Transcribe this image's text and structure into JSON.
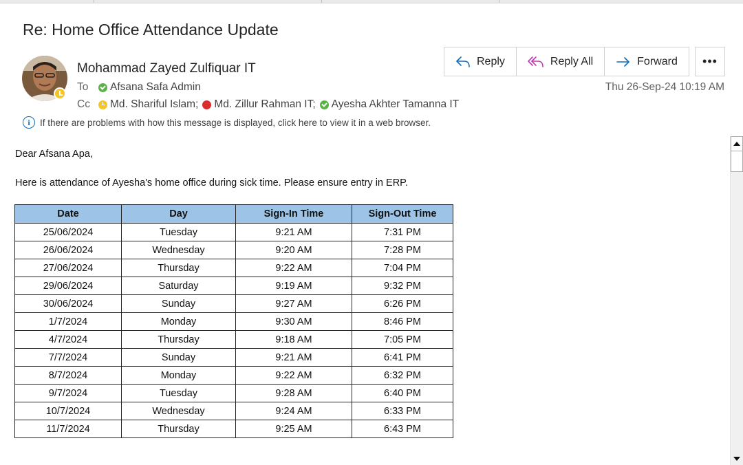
{
  "message": {
    "subject": "Re: Home Office Attendance Update",
    "sender": "Mohammad Zayed Zulfiquar IT",
    "to_label": "To",
    "cc_label": "Cc",
    "to": [
      {
        "name": "Afsana Safa Admin",
        "status": "available"
      }
    ],
    "cc": [
      {
        "name": "Md. Shariful Islam;",
        "status": "away"
      },
      {
        "name": "Md. Zillur Rahman IT;",
        "status": "busy"
      },
      {
        "name": "Ayesha Akhter Tamanna IT",
        "status": "available"
      }
    ],
    "date": "Thu 26-Sep-24 10:19 AM",
    "info_bar": "If there are problems with how this message is displayed, click here to view it in a web browser."
  },
  "actions": {
    "reply": "Reply",
    "reply_all": "Reply All",
    "forward": "Forward",
    "more": "•••"
  },
  "body": {
    "greeting": "Dear Afsana Apa,",
    "paragraph": "Here is attendance of Ayesha's home office during sick time. Please ensure entry in ERP."
  },
  "table": {
    "headers": [
      "Date",
      "Day",
      "Sign-In Time",
      "Sign-Out Time"
    ],
    "rows": [
      [
        "25/06/2024",
        "Tuesday",
        "9:21 AM",
        "7:31 PM"
      ],
      [
        "26/06/2024",
        "Wednesday",
        "9:20 AM",
        "7:28 PM"
      ],
      [
        "27/06/2024",
        "Thursday",
        "9:22 AM",
        "7:04 PM"
      ],
      [
        "29/06/2024",
        "Saturday",
        "9:19 AM",
        "9:32 PM"
      ],
      [
        "30/06/2024",
        "Sunday",
        "9:27 AM",
        "6:26 PM"
      ],
      [
        "1/7/2024",
        "Monday",
        "9:30 AM",
        "8:46 PM"
      ],
      [
        "4/7/2024",
        "Thursday",
        "9:18 AM",
        "7:05 PM"
      ],
      [
        "7/7/2024",
        "Sunday",
        "9:21 AM",
        "6:41 PM"
      ],
      [
        "8/7/2024",
        "Monday",
        "9:22 AM",
        "6:32 PM"
      ],
      [
        "9/7/2024",
        "Tuesday",
        "9:28 AM",
        "6:40 PM"
      ],
      [
        "10/7/2024",
        "Wednesday",
        "9:24 AM",
        "6:33 PM"
      ],
      [
        "11/7/2024",
        "Thursday",
        "9:25 AM",
        "6:43 PM"
      ]
    ]
  },
  "icons": {
    "reply": "reply-arrow-icon",
    "reply_all": "reply-all-arrow-icon",
    "forward": "forward-arrow-icon",
    "info": "info-circle-icon",
    "presence_available": "presence-available-icon",
    "presence_away": "presence-away-icon",
    "presence_busy": "presence-busy-icon"
  },
  "colors": {
    "accent": "#0f6cbd",
    "table_header": "#9dc3e6",
    "available": "#59b247",
    "away": "#f3c623",
    "busy": "#d92c2c"
  }
}
